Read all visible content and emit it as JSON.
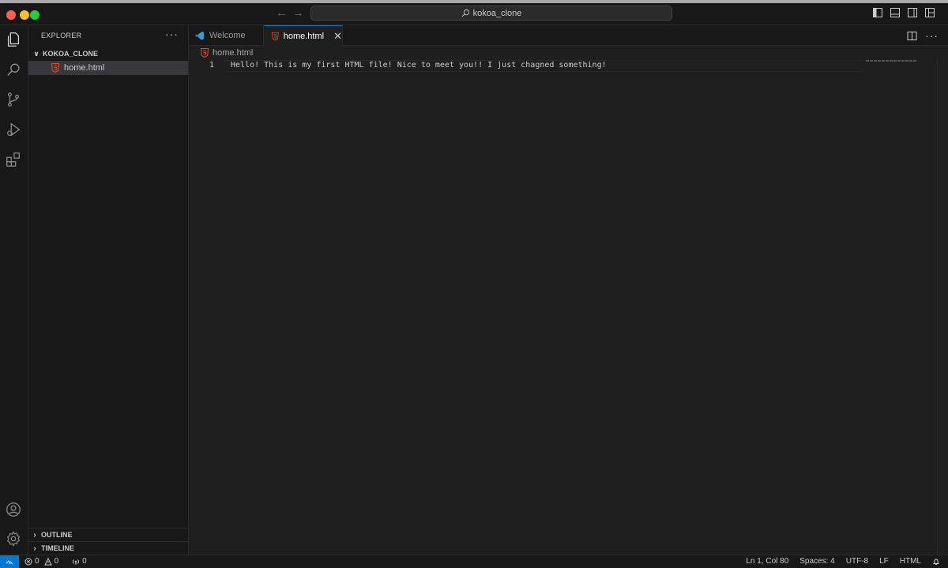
{
  "window": {
    "search_text": "kokoa_clone"
  },
  "sidebar": {
    "header": "EXPLORER",
    "folder": "KOKOA_CLONE",
    "file": "home.html",
    "sections": [
      "OUTLINE",
      "TIMELINE"
    ]
  },
  "tabs": [
    {
      "label": "Welcome",
      "active": false
    },
    {
      "label": "home.html",
      "active": true
    }
  ],
  "breadcrumb": "home.html",
  "editor": {
    "line_number": "1",
    "code": "Hello! This is my first HTML file! Nice to meet you!! I just chagned something!"
  },
  "status": {
    "errors": "0",
    "warnings": "0",
    "ports": "0",
    "position": "Ln 1, Col 80",
    "spaces": "Spaces: 4",
    "encoding": "UTF-8",
    "eol": "LF",
    "language": "HTML"
  },
  "colors": {
    "accent": "#0078d4",
    "html_icon": "#e44d26",
    "vscode_icon": "#3c99d4"
  }
}
